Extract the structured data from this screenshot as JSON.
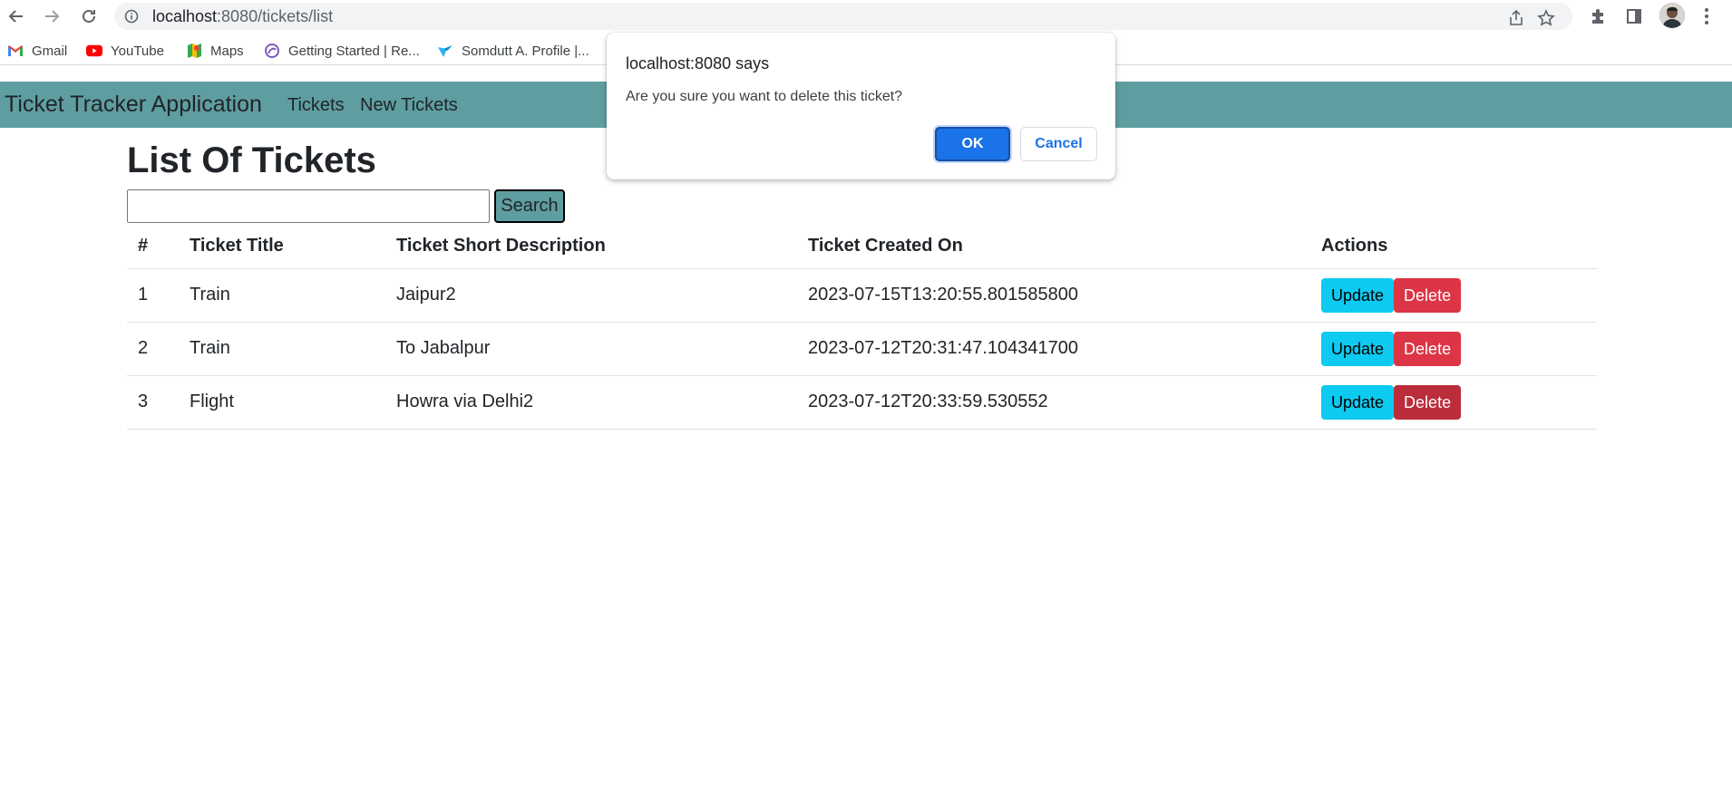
{
  "browser": {
    "url_host": "localhost",
    "url_path": ":8080/tickets/list",
    "bookmarks": [
      {
        "label": "Gmail",
        "icon": "gmail-icon"
      },
      {
        "label": "YouTube",
        "icon": "youtube-icon"
      },
      {
        "label": "Maps",
        "icon": "maps-icon"
      },
      {
        "label": "Getting Started | Re...",
        "icon": "redux-icon"
      },
      {
        "label": "Somdutt A. Profile |...",
        "icon": "profile-site-icon"
      }
    ]
  },
  "navbar": {
    "brand": "Ticket Tracker Application",
    "links": [
      "Tickets",
      "New Tickets"
    ],
    "color": "#5f9ea0"
  },
  "main": {
    "title": "List Of Tickets",
    "search": {
      "value": "",
      "button_label": "Search"
    },
    "table": {
      "headers": [
        "#",
        "Ticket Title",
        "Ticket Short Description",
        "Ticket Created On",
        "Actions"
      ],
      "rows": [
        {
          "num": "1",
          "title": "Train",
          "desc": "Jaipur2",
          "created": "2023-07-15T13:20:55.801585800"
        },
        {
          "num": "2",
          "title": "Train",
          "desc": "To Jabalpur",
          "created": "2023-07-12T20:31:47.104341700"
        },
        {
          "num": "3",
          "title": "Flight",
          "desc": "Howra via Delhi2",
          "created": "2023-07-12T20:33:59.530552"
        }
      ],
      "update_label": "Update",
      "delete_label": "Delete"
    }
  },
  "dialog": {
    "title": "localhost:8080 says",
    "message": "Are you sure you want to delete this ticket?",
    "ok_label": "OK",
    "cancel_label": "Cancel"
  }
}
